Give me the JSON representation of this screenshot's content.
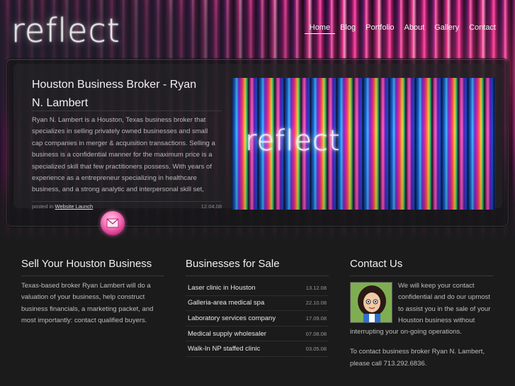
{
  "brand": {
    "logo_text": "reflect"
  },
  "nav": {
    "items": [
      {
        "label": "Home",
        "active": true
      },
      {
        "label": "Blog"
      },
      {
        "label": "Portfolio"
      },
      {
        "label": "About"
      },
      {
        "label": "Gallery"
      },
      {
        "label": "Contact"
      }
    ]
  },
  "featured": {
    "title": "Houston Business Broker - Ryan N. Lambert",
    "body": "Ryan N. Lambert is a Houston, Texas business broker that specializes in selling privately owned businesses and small cap companies in merger & acquisition transactions. Selling a business is a confidential manner for the maximum price is a specialized skill that few practitioners possess. With years of experience as a entrepreneur specializing in healthcare business, and a strong analytic and interpersonal skill set, Ryan N. Lambert is the premier mergers and acquisitions consultant",
    "meta_prefix": "posted in",
    "meta_link": "Website Launch",
    "date": "12.04.08",
    "image_logo_text": "reflect"
  },
  "col_sell": {
    "heading": "Sell Your Houston Business",
    "text": "Texas-based broker Ryan Lambert will do a valuation of your business, help construct business financials, a marketing packet, and most importantly: contact qualified buyers."
  },
  "col_sale": {
    "heading": "Businesses for Sale",
    "items": [
      {
        "name": "Laser clinic in Houston",
        "date": "13.12.08"
      },
      {
        "name": "Galleria-area medical spa",
        "date": "22.10.08"
      },
      {
        "name": "Laboratory services company",
        "date": "17.09.08"
      },
      {
        "name": "Medical supply wholesaler",
        "date": "07.08.08"
      },
      {
        "name": "Walk-In NP staffed clinic",
        "date": "03.05.08"
      }
    ]
  },
  "col_contact": {
    "heading": "Contact Us",
    "text1": "We will keep your contact confidential and do our upmost to assist you in the sale of your Houston business without interrupting your on-going operations.",
    "text2": "To contact business broker Ryan N. Lambert, please call 713.292.6836."
  },
  "colors": {
    "accent": "#ff69b4",
    "background": "#1b1b1c"
  }
}
